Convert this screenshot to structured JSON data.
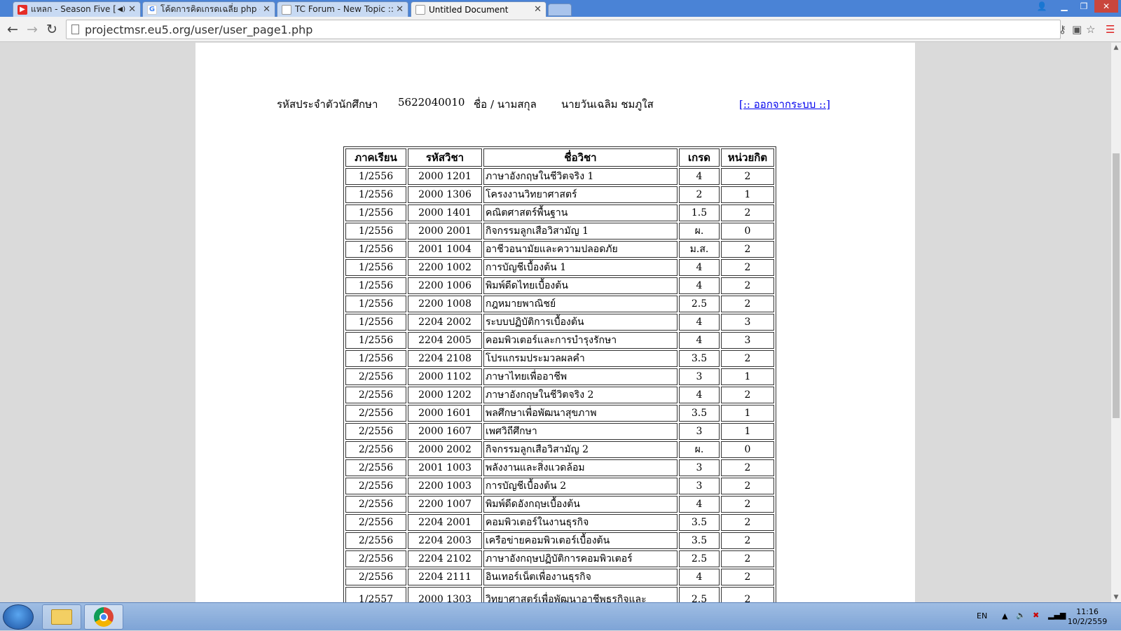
{
  "browser": {
    "tabs": [
      {
        "title": "แหลก - Season Five [Lyr",
        "favicon": "youtube-icon",
        "active": false
      },
      {
        "title": "โค้ดการคิดเกรดเฉลี่ย php -",
        "favicon": "google-icon",
        "active": false
      },
      {
        "title": "TC Forum - New Topic :: ก",
        "favicon": "page-icon",
        "active": false
      },
      {
        "title": "Untitled Document",
        "favicon": "page-icon",
        "active": true
      }
    ],
    "url": "projectmsr.eu5.org/user/user_page1.php"
  },
  "header": {
    "student_id_label": "รหัสประจำตัวนักศึกษา",
    "student_id": "5622040010",
    "name_label": "ชื่อ / นามสกุล",
    "name": "นายวันเฉลิม ชมภูใส",
    "logout": "[:: ออกจากระบบ ::]"
  },
  "table": {
    "columns": [
      "ภาคเรียน",
      "รหัสวิชา",
      "ชื่อวิชา",
      "เกรด",
      "หน่วยกิต"
    ],
    "rows": [
      [
        "1/2556",
        "2000 1201",
        "ภาษาอังกฤษในชีวิตจริง 1",
        "4",
        "2"
      ],
      [
        "1/2556",
        "2000 1306",
        "โครงงานวิทยาศาสตร์",
        "2",
        "1"
      ],
      [
        "1/2556",
        "2000 1401",
        "คณิตศาสตร์พื้นฐาน",
        "1.5",
        "2"
      ],
      [
        "1/2556",
        "2000 2001",
        "กิจกรรมลูกเสือวิสามัญ 1",
        "ผ.",
        "0"
      ],
      [
        "1/2556",
        "2001 1004",
        "อาชีวอนามัยและความปลอดภัย",
        "ม.ส.",
        "2"
      ],
      [
        "1/2556",
        "2200 1002",
        "การบัญชีเบื้องต้น 1",
        "4",
        "2"
      ],
      [
        "1/2556",
        "2200 1006",
        "พิมพ์ดีดไทยเบื้องต้น",
        "4",
        "2"
      ],
      [
        "1/2556",
        "2200 1008",
        "กฎหมายพาณิชย์",
        "2.5",
        "2"
      ],
      [
        "1/2556",
        "2204 2002",
        "ระบบปฏิบัติการเบื้องต้น",
        "4",
        "3"
      ],
      [
        "1/2556",
        "2204 2005",
        "คอมพิวเตอร์และการบำรุงรักษา",
        "4",
        "3"
      ],
      [
        "1/2556",
        "2204 2108",
        "โปรแกรมประมวลผลคำ",
        "3.5",
        "2"
      ],
      [
        "2/2556",
        "2000 1102",
        "ภาษาไทยเพื่ออาชีพ",
        "3",
        "1"
      ],
      [
        "2/2556",
        "2000 1202",
        "ภาษาอังกฤษในชีวิตจริง 2",
        "4",
        "2"
      ],
      [
        "2/2556",
        "2000 1601",
        "พลศึกษาเพื่อพัฒนาสุขภาพ",
        "3.5",
        "1"
      ],
      [
        "2/2556",
        "2000 1607",
        "เพศวิถีศึกษา",
        "3",
        "1"
      ],
      [
        "2/2556",
        "2000 2002",
        "กิจกรรมลูกเสือวิสามัญ 2",
        "ผ.",
        "0"
      ],
      [
        "2/2556",
        "2001 1003",
        "พลังงานและสิ่งแวดล้อม",
        "3",
        "2"
      ],
      [
        "2/2556",
        "2200 1003",
        "การบัญชีเบื้องต้น 2",
        "3",
        "2"
      ],
      [
        "2/2556",
        "2200 1007",
        "พิมพ์ดีดอังกฤษเบื้องต้น",
        "4",
        "2"
      ],
      [
        "2/2556",
        "2204 2001",
        "คอมพิวเตอร์ในงานธุรกิจ",
        "3.5",
        "2"
      ],
      [
        "2/2556",
        "2204 2003",
        "เครือข่ายคอมพิวเตอร์เบื้องต้น",
        "3.5",
        "2"
      ],
      [
        "2/2556",
        "2204 2102",
        "ภาษาอังกฤษปฏิบัติการคอมพิวเตอร์",
        "2.5",
        "2"
      ],
      [
        "2/2556",
        "2204 2111",
        "อินเทอร์เน็ตเพื่องานธุรกิจ",
        "4",
        "2"
      ],
      [
        "1/2557",
        "2000 1303",
        "วิทยาศาสตร์เพื่อพัฒนาอาชีพธุรกิจและ",
        "2.5",
        "2"
      ]
    ]
  },
  "taskbar": {
    "lang": "EN",
    "time": "11:16",
    "date": "10/2/2559"
  }
}
